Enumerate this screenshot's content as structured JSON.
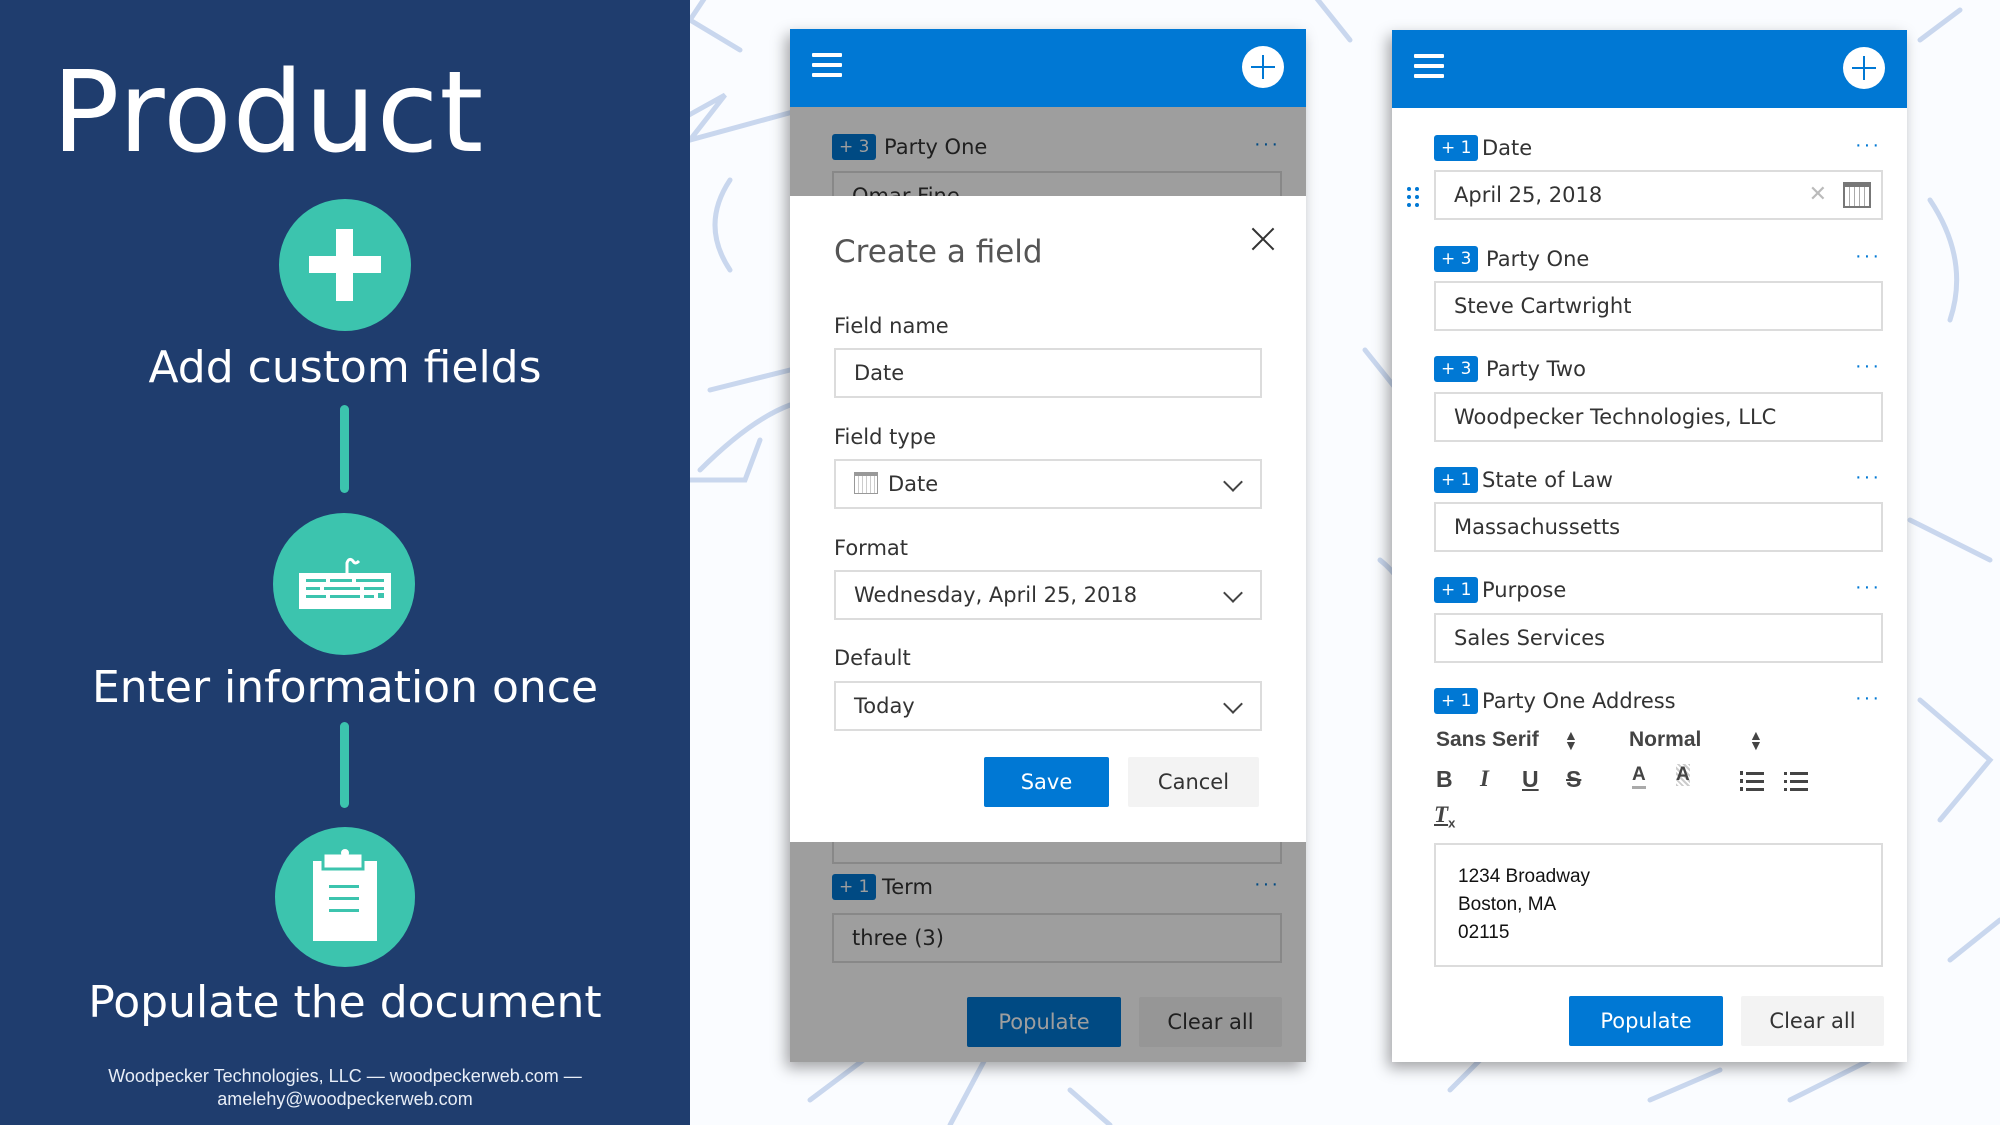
{
  "slide": {
    "title": "Product",
    "steps": [
      {
        "icon": "plus-icon",
        "label": "Add custom fields"
      },
      {
        "icon": "keyboard-icon",
        "label": "Enter information once"
      },
      {
        "icon": "clipboard-icon",
        "label": "Populate the document"
      }
    ],
    "footer_line1": "Woodpecker Technologies, LLC — woodpeckerweb.com —",
    "footer_line2": "amelehy@woodpeckerweb.com",
    "colors": {
      "navy": "#1f3d6e",
      "teal": "#3cc4ae",
      "accent": "#0078d4"
    }
  },
  "left_app": {
    "background_field": {
      "badge": "+ 3",
      "label": "Party One",
      "value": "Omar Fine",
      "more": "···"
    },
    "term_field": {
      "badge": "+ 1",
      "label": "Term",
      "value": "three (3)",
      "more": "···"
    },
    "populate_label": "Populate",
    "clear_label": "Clear all",
    "dialog": {
      "title": "Create a field",
      "field_name_label": "Field name",
      "field_name_value": "Date",
      "field_type_label": "Field type",
      "field_type_value": "Date",
      "format_label": "Format",
      "format_value": "Wednesday, April 25, 2018",
      "default_label": "Default",
      "default_value": "Today",
      "save_label": "Save",
      "cancel_label": "Cancel"
    }
  },
  "right_app": {
    "fields": [
      {
        "badge": "+ 1",
        "label": "Date",
        "value": "April 25, 2018",
        "more": "···"
      },
      {
        "badge": "+ 3",
        "label": "Party One",
        "value": "Steve Cartwright",
        "more": "···"
      },
      {
        "badge": "+ 3",
        "label": "Party Two",
        "value": "Woodpecker Technologies, LLC",
        "more": "···"
      },
      {
        "badge": "+ 1",
        "label": "State of Law",
        "value": "Massachussetts",
        "more": "···"
      },
      {
        "badge": "+ 1",
        "label": "Purpose",
        "value": "Sales Services",
        "more": "···"
      },
      {
        "badge": "+ 1",
        "label": "Party One Address",
        "more": "···"
      }
    ],
    "editor": {
      "font_select": "Sans Serif",
      "size_select": "Normal",
      "address_lines": [
        "1234 Broadway",
        "Boston, MA",
        "02115"
      ]
    },
    "populate_label": "Populate",
    "clear_label": "Clear all"
  }
}
